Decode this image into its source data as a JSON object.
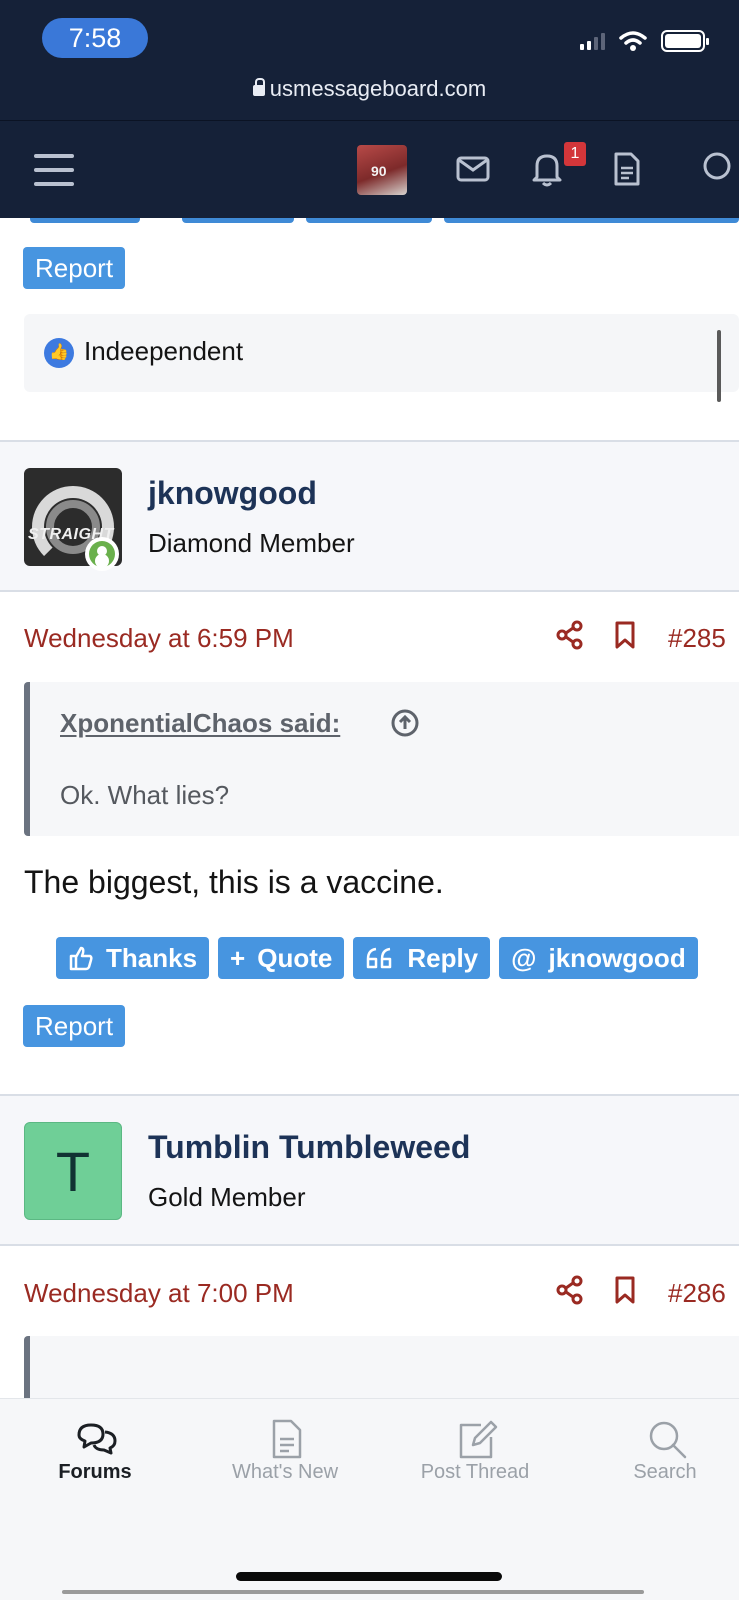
{
  "status_bar": {
    "time": "7:58"
  },
  "browser": {
    "url": "usmessageboard.com"
  },
  "navbar": {
    "notification_count": "1"
  },
  "previous_post": {
    "report_label": "Report",
    "reaction_user": "Indeependent"
  },
  "post1": {
    "username": "jknowgood",
    "user_title": "Diamond Member",
    "avatar_text": "STRAIGHT",
    "date": "Wednesday at 6:59 PM",
    "post_number": "#285",
    "quote_author": "XponentialChaos said:",
    "quote_text": "Ok. What lies?",
    "message": "The biggest, this is a vaccine.",
    "buttons": {
      "thanks": "Thanks",
      "quote": "Quote",
      "reply": "Reply",
      "mention": "jknowgood",
      "report": "Report"
    }
  },
  "post2": {
    "username": "Tumblin Tumbleweed",
    "user_title": "Gold Member",
    "avatar_letter": "T",
    "date": "Wednesday at 7:00 PM",
    "post_number": "#286"
  },
  "tabbar": {
    "tabs": [
      {
        "label": "Forums",
        "icon": "chat-bubbles-icon",
        "active": true
      },
      {
        "label": "What's New",
        "icon": "document-icon",
        "active": false
      },
      {
        "label": "Post Thread",
        "icon": "edit-icon",
        "active": false
      },
      {
        "label": "Search",
        "icon": "search-icon",
        "active": false
      }
    ]
  },
  "colors": {
    "header_bg": "#152138",
    "button_blue": "#4795e0",
    "date_red": "#9a2a22",
    "username_navy": "#1d3357"
  }
}
